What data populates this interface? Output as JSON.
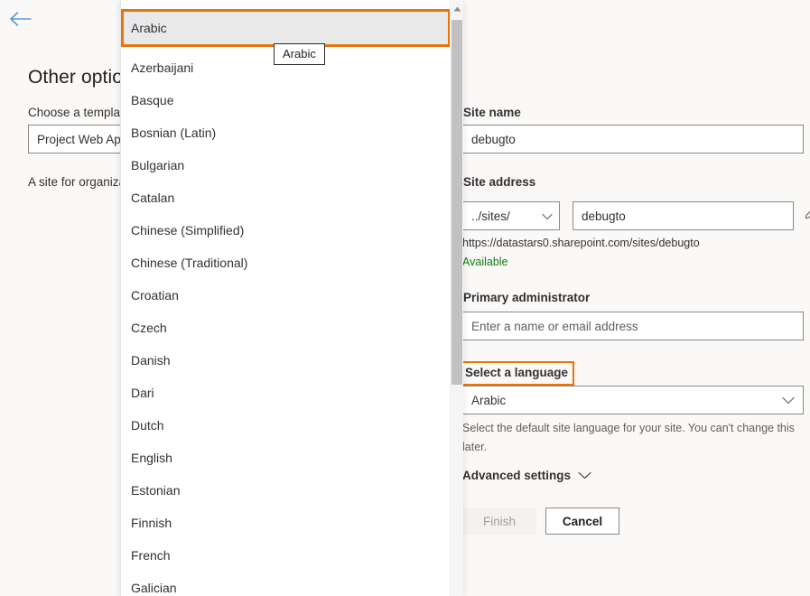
{
  "background_page": {
    "back_button_icon": "arrow-left-icon",
    "title": "Other options",
    "choose_template_label": "Choose a template",
    "template_value": "Project Web App Site",
    "template_description": "A site for organizations managing projects with Project Web App."
  },
  "form": {
    "site_name": {
      "label": "Site name",
      "value": "debugto"
    },
    "site_address": {
      "label": "Site address",
      "path_prefix": "../sites/",
      "value": "debugto",
      "preview_url": "https://datastars0.sharepoint.com/sites/debugto",
      "availability": "Available",
      "edit_icon": "pencil-icon"
    },
    "primary_administrator": {
      "label": "Primary administrator",
      "placeholder": "Enter a name or email address",
      "value": ""
    },
    "language": {
      "label": "Select a language",
      "value": "Arabic",
      "help_text": "Select the default site language for your site. You can't change this later.",
      "chevron_icon": "chevron-down-icon"
    },
    "advanced_settings": {
      "label": "Advanced settings",
      "chevron_icon": "chevron-down-icon"
    },
    "buttons": {
      "finish": "Finish",
      "cancel": "Cancel"
    }
  },
  "dropdown": {
    "tooltip": "Arabic",
    "selected": "Arabic",
    "scroll_up_icon": "caret-up-icon",
    "items": [
      {
        "label": "Arabic"
      },
      {
        "label": "Azerbaijani"
      },
      {
        "label": "Basque"
      },
      {
        "label": "Bosnian (Latin)"
      },
      {
        "label": "Bulgarian"
      },
      {
        "label": "Catalan"
      },
      {
        "label": "Chinese (Simplified)"
      },
      {
        "label": "Chinese (Traditional)"
      },
      {
        "label": "Croatian"
      },
      {
        "label": "Czech"
      },
      {
        "label": "Danish"
      },
      {
        "label": "Dari"
      },
      {
        "label": "Dutch"
      },
      {
        "label": "English"
      },
      {
        "label": "Estonian"
      },
      {
        "label": "Finnish"
      },
      {
        "label": "French"
      },
      {
        "label": "Galician"
      }
    ]
  },
  "colors": {
    "accent_highlight": "#e8740c",
    "available_green": "#107c10",
    "back_arrow_blue": "#5b9bd5",
    "page_background": "#faf9f8"
  }
}
